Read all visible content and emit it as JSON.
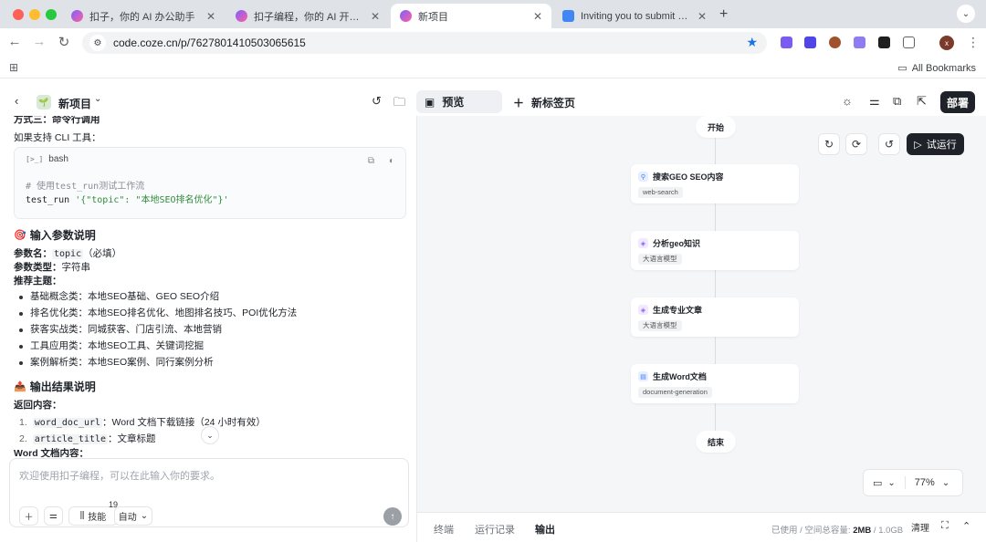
{
  "browser": {
    "tabs": [
      {
        "title": "扣子，你的 AI 办公助手",
        "active": false
      },
      {
        "title": "扣子编程，你的 AI 开发伙伴，",
        "active": false
      },
      {
        "title": "新项目",
        "active": true
      },
      {
        "title": "Inviting you to submit files",
        "active": false
      }
    ],
    "url": "code.coze.cn/p/7627801410503065615",
    "avatar_letter": "x",
    "bookmarks_label": "All Bookmarks"
  },
  "header": {
    "project_title": "新项目",
    "preview_tab": "预览",
    "new_tab": "新标签页",
    "deploy": "部署"
  },
  "chat": {
    "doc": {
      "partial_heading": "方式三：命令行调用",
      "cli_intro": "如果支持 CLI 工具：",
      "code_lang": "bash",
      "code_comment": "# 使用test_run测试工作流",
      "code_cmd": "test_run",
      "code_arg": "'{\"topic\": \"本地SEO排名优化\"}'",
      "input_section": "输入参数说明",
      "param_name_label": "参数名：",
      "param_name": "topic",
      "param_required": "（必填）",
      "param_type_label": "参数类型：",
      "param_type": "字符串",
      "recommend_label": "推荐主题：",
      "topics": [
        "基础概念类：本地SEO基础、GEO SEO介绍",
        "排名优化类：本地SEO排名优化、地图排名技巧、POI优化方法",
        "获客实战类：同城获客、门店引流、本地营销",
        "工具应用类：本地SEO工具、关键词挖掘",
        "案例解析类：本地SEO案例、同行案例分析"
      ],
      "output_section": "输出结果说明",
      "return_label": "返回内容：",
      "outputs": [
        {
          "num": "1.",
          "key": "word_doc_url",
          "desc": "：Word 文档下载链接（24 小时有效）"
        },
        {
          "num": "2.",
          "key": "article_title",
          "desc": "：文章标题"
        }
      ],
      "cut_line": "Word 文档内容："
    },
    "input_placeholder": "欢迎使用扣子编程，可以在此输入你的要求。",
    "skills_label": "技能",
    "skills_count": "19",
    "mode_label": "自动"
  },
  "workflow": {
    "start": "开始",
    "end": "结束",
    "nodes": [
      {
        "title": "搜索GEO SEO内容",
        "tag": "web-search",
        "color": "#3d7bf6"
      },
      {
        "title": "分析geo知识",
        "tag": "大语言模型",
        "color": "#8b5cf6"
      },
      {
        "title": "生成专业文章",
        "tag": "大语言模型",
        "color": "#8b5cf6"
      },
      {
        "title": "生成Word文档",
        "tag": "document-generation",
        "color": "#3d7bf6"
      }
    ],
    "run_label": "试运行",
    "zoom": "77%"
  },
  "bottom": {
    "tabs": [
      "终端",
      "运行记录",
      "输出"
    ],
    "active_tab": "输出",
    "storage_prefix": "已使用 / 空间总容量:",
    "storage_used": "2MB",
    "storage_total": "1.0GB",
    "clear": "清理"
  }
}
